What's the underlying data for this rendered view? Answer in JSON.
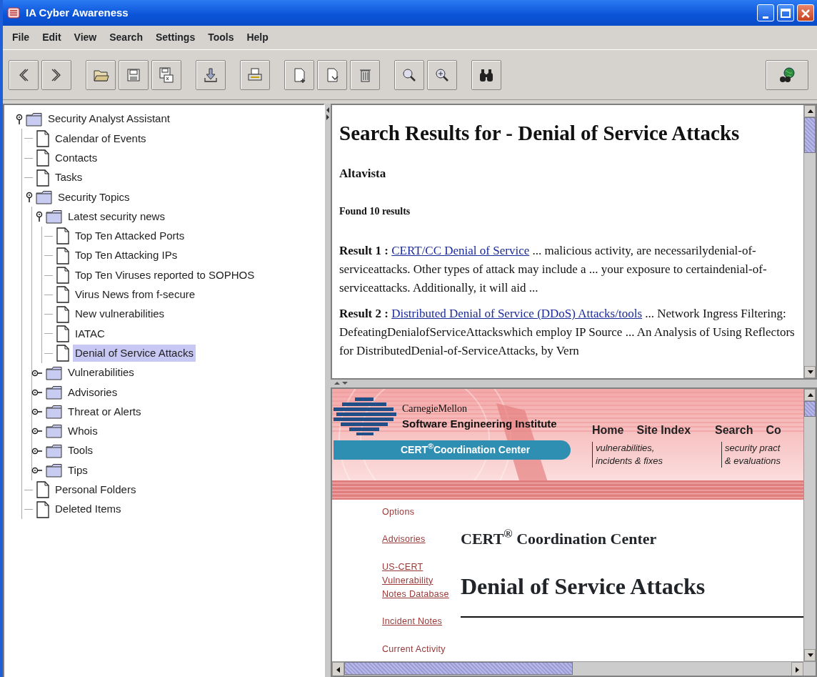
{
  "window": {
    "title": "IA Cyber Awareness"
  },
  "menu": [
    "File",
    "Edit",
    "View",
    "Search",
    "Settings",
    "Tools",
    "Help"
  ],
  "tree": [
    {
      "label": "Security Analyst Assistant",
      "kind": "folder",
      "expanded": true,
      "selected": false,
      "children": [
        {
          "label": "Calendar of Events",
          "kind": "document",
          "selected": false
        },
        {
          "label": "Contacts",
          "kind": "document",
          "selected": false
        },
        {
          "label": "Tasks",
          "kind": "document",
          "selected": false
        },
        {
          "label": "Security Topics",
          "kind": "folder",
          "expanded": true,
          "selected": false,
          "children": [
            {
              "label": "Latest security news",
              "kind": "folder",
              "expanded": true,
              "selected": false,
              "children": [
                {
                  "label": "Top Ten Attacked Ports",
                  "kind": "document",
                  "selected": false
                },
                {
                  "label": "Top Ten Attacking IPs",
                  "kind": "document",
                  "selected": false
                },
                {
                  "label": "Top Ten Viruses reported to SOPHOS",
                  "kind": "document",
                  "selected": false
                },
                {
                  "label": "Virus News from f-secure",
                  "kind": "document",
                  "selected": false
                },
                {
                  "label": "New vulnerabilities",
                  "kind": "document",
                  "selected": false
                },
                {
                  "label": "IATAC",
                  "kind": "document",
                  "selected": false
                },
                {
                  "label": "Denial of Service Attacks",
                  "kind": "document",
                  "selected": true
                }
              ]
            },
            {
              "label": "Vulnerabilities",
              "kind": "folder",
              "expanded": false,
              "selected": false
            },
            {
              "label": "Advisories",
              "kind": "folder",
              "expanded": false,
              "selected": false
            },
            {
              "label": "Threat or Alerts",
              "kind": "folder",
              "expanded": false,
              "selected": false
            },
            {
              "label": "Whois",
              "kind": "folder",
              "expanded": false,
              "selected": false
            },
            {
              "label": "Tools",
              "kind": "folder",
              "expanded": false,
              "selected": false
            },
            {
              "label": "Tips",
              "kind": "folder",
              "expanded": false,
              "selected": false
            }
          ]
        },
        {
          "label": "Personal Folders",
          "kind": "document",
          "selected": false
        },
        {
          "label": "Deleted Items",
          "kind": "document",
          "selected": false
        }
      ]
    }
  ],
  "search_results": {
    "heading": "Search Results for - Denial of Service Attacks",
    "engine": "Altavista",
    "count": "Found 10 results",
    "results": [
      {
        "label": "Result 1 :",
        "link": "CERT/CC Denial of Service",
        "text": " ... malicious activity, are necessarilydenial-of-serviceattacks. Other types of attack may include a ... your exposure to certaindenial-of-serviceattacks. Additionally, it will aid ..."
      },
      {
        "label": "Result 2 :",
        "link": "Distributed Denial of Service (DDoS) Attacks/tools",
        "text": " ... Network Ingress Filtering: DefeatingDenialofServiceAttackswhich employ IP Source ... An Analysis of Using Reflectors for DistributedDenial-of-ServiceAttacks, by Vern"
      }
    ]
  },
  "web_page": {
    "banner": {
      "org": "CarnegieMellon",
      "institute": "Software Engineering Institute",
      "center": "CERT$^{®}$Coordination Center",
      "nav": [
        "Home",
        "Site Index",
        "Search",
        "Co"
      ],
      "taglines": [
        [
          "vulnerabilities,",
          "incidents & fixes"
        ],
        [
          "security pract",
          "& evaluations"
        ]
      ]
    },
    "sidebar": [
      {
        "label": "Options",
        "kind": "text"
      },
      {
        "label": "Advisories",
        "kind": "link"
      },
      {
        "label": "US-CERT Vulnerability Notes Database",
        "kind": "link"
      },
      {
        "label": "Incident Notes",
        "kind": "link"
      },
      {
        "label": "Current Activity",
        "kind": "text"
      }
    ],
    "title": "CERT$^{®}$ Coordination Center",
    "heading": "Denial of Service Attacks"
  }
}
